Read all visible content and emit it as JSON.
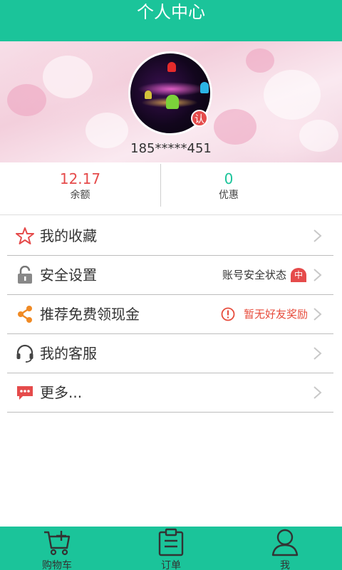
{
  "header": {
    "title": "个人中心"
  },
  "profile": {
    "phone": "185*****451",
    "verify_badge": "认"
  },
  "stats": [
    {
      "value": "12.17",
      "label": "余额",
      "color": "#e54b4b"
    },
    {
      "value": "0",
      "label": "优惠",
      "color": "#1bc49a"
    }
  ],
  "menu": [
    {
      "label": "我的收藏",
      "icon": "star-icon"
    },
    {
      "label": "安全设置",
      "icon": "lock-icon",
      "extra": "账号安全状态",
      "badge": "中"
    },
    {
      "label": "推荐免费领现金",
      "icon": "share-icon",
      "extra": "暂无好友奖励"
    },
    {
      "label": "我的客服",
      "icon": "headset-icon"
    },
    {
      "label": "更多...",
      "icon": "chat-bubble-icon"
    }
  ],
  "tabbar": [
    {
      "label": "购物车",
      "icon": "cart-icon"
    },
    {
      "label": "订单",
      "icon": "clipboard-icon"
    },
    {
      "label": "我",
      "icon": "user-icon"
    }
  ],
  "colors": {
    "accent": "#1bc49a",
    "danger": "#e54b4b",
    "icon_orange": "#f08a24"
  }
}
